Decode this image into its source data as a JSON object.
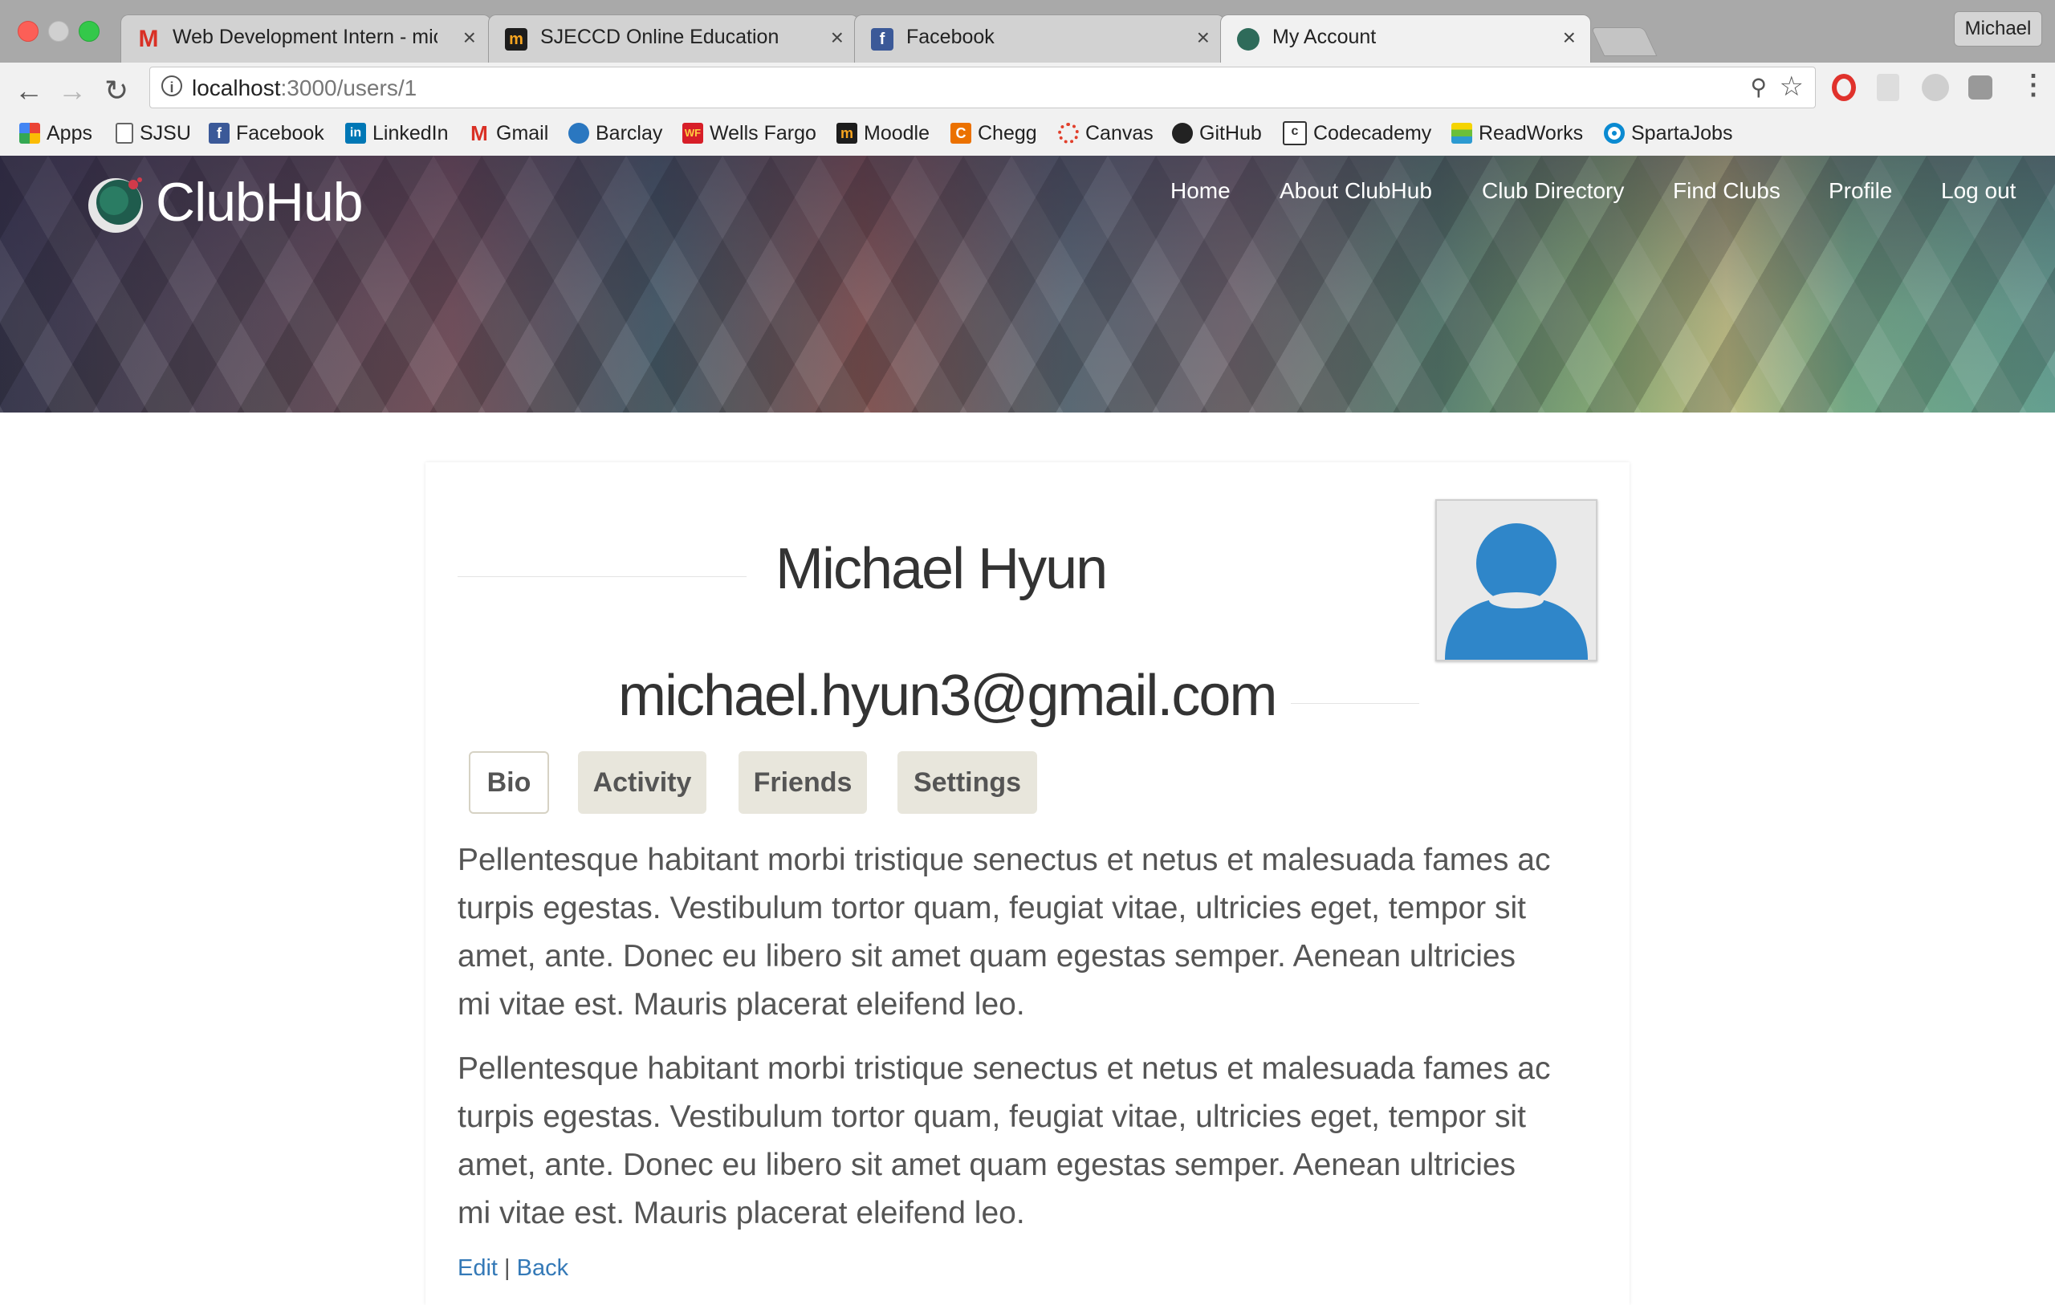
{
  "browser": {
    "profile_name": "Michael",
    "tabs": [
      {
        "title": "Web Development Intern - mic",
        "icon": "gmail-icon"
      },
      {
        "title": "SJECCD Online Education",
        "icon": "moodle-icon"
      },
      {
        "title": "Facebook",
        "icon": "facebook-icon"
      },
      {
        "title": "My Account",
        "icon": "clubhub-icon"
      }
    ],
    "close_glyph": "×",
    "url_host": "localhost",
    "url_rest": ":3000/users/1",
    "bookmarks": [
      "Apps",
      "SJSU",
      "Facebook",
      "LinkedIn",
      "Gmail",
      "Barclay",
      "Wells Fargo",
      "Moodle",
      "Chegg",
      "Canvas",
      "GitHub",
      "Codecademy",
      "ReadWorks",
      "SpartaJobs"
    ]
  },
  "site": {
    "logo_text": "ClubHub",
    "nav": [
      "Home",
      "About ClubHub",
      "Club Directory",
      "Find Clubs",
      "Profile",
      "Log out"
    ]
  },
  "profile": {
    "name": "Michael Hyun",
    "email": "michael.hyun3@gmail.com",
    "tabs": [
      "Bio",
      "Activity",
      "Friends",
      "Settings"
    ],
    "active_tab": "Bio",
    "bio_paragraphs": [
      "Pellentesque habitant morbi tristique senectus et netus et malesuada fames ac turpis egestas. Vestibulum tortor quam, feugiat vitae, ultricies eget, tempor sit amet, ante. Donec eu libero sit amet quam egestas semper. Aenean ultricies mi vitae est. Mauris placerat eleifend leo.",
      "Pellentesque habitant morbi tristique senectus et netus et malesuada fames ac turpis egestas. Vestibulum tortor quam, feugiat vitae, ultricies eget, tempor sit amet, ante. Donec eu libero sit amet quam egestas semper. Aenean ultricies mi vitae est. Mauris placerat eleifend leo."
    ],
    "edit_label": "Edit",
    "separator": "|",
    "back_label": "Back"
  },
  "colors": {
    "link": "#3479b7",
    "avatar_blue": "#2f86c9",
    "tab_inactive_bg": "#e8e6dc"
  }
}
